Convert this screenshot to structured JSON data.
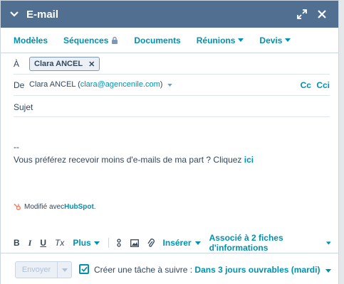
{
  "window": {
    "title": "E-mail"
  },
  "tabs": [
    {
      "label": "Modèles",
      "icon": ""
    },
    {
      "label": "Séquences",
      "icon": "lock-icon"
    },
    {
      "label": "Documents",
      "icon": ""
    },
    {
      "label": "Réunions",
      "icon": "caret-down-icon"
    },
    {
      "label": "Devis",
      "icon": "caret-down-icon"
    }
  ],
  "to": {
    "label": "À",
    "recipient": "Clara ANCEL",
    "remove": "✕"
  },
  "from": {
    "label": "De",
    "name": "Clara ANCEL (",
    "email": "clara@agencenile.com",
    "close": ")",
    "cc": "Cc",
    "cci": "Cci"
  },
  "subject": {
    "label": "Sujet"
  },
  "body": {
    "signature_sep": "--",
    "unsubscribe_text": "Vous préférez recevoir moins d'e-mails de ma part ? Cliquez ",
    "unsubscribe_link": "ici",
    "powered_prefix": "Modifié avec ",
    "powered_brand": "HubSpot",
    "powered_suffix": "."
  },
  "toolbar": {
    "bold": "B",
    "italic": "I",
    "underline": "U",
    "clear": "Tx",
    "more": "Plus",
    "insert": "Insérer",
    "associated": "Associé à 2 fiches d'informations"
  },
  "footer": {
    "send": "Envoyer",
    "task_prefix": "Créer une tâche à suivre : ",
    "task_due": "Dans 3 jours ouvrables (mardi)"
  },
  "colors": {
    "header": "#516f90",
    "accent": "#0091ae",
    "text": "#33475b",
    "hubspot": "#ff7a59"
  }
}
